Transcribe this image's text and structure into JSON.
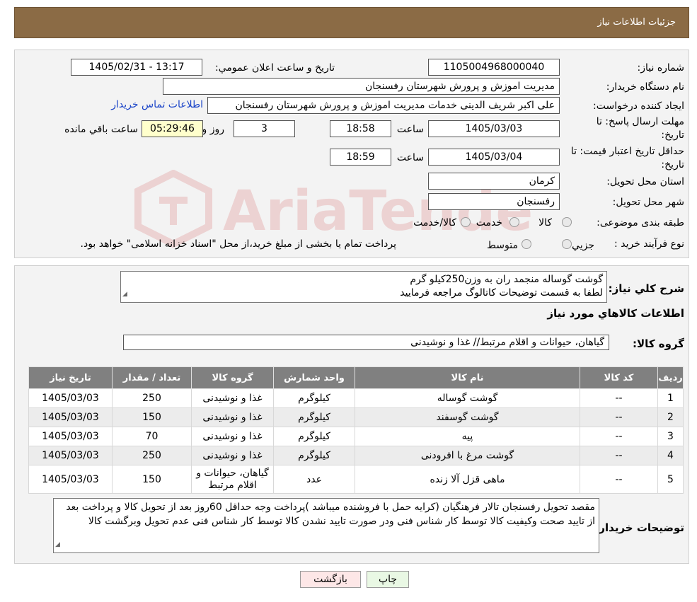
{
  "header": {
    "title": "جزئیات اطلاعات نیاز"
  },
  "watermark": {
    "text": "AriaTender.neT"
  },
  "form": {
    "need_number_label": "شماره نیاز:",
    "need_number": "1105004968000040",
    "announce_label": "تاریخ و ساعت اعلان عمومي:",
    "announce_value": "1405/02/31 - 13:17",
    "buyer_org_label": "نام دستگاه خريدار:",
    "buyer_org": "مديريت اموزش و پرورش شهرستان رفسنجان",
    "creator_label": "ايجاد کننده درخواست:",
    "creator": "علی اکبر شریف الدینی خدمات مدیریت اموزش و پرورش شهرستان رفسنجان",
    "contact_link": "اطلاعات تماس خريدار",
    "reply_deadline_label_1": "مهلت ارسال پاسخ: تا",
    "reply_deadline_label_2": "تاريخ:",
    "reply_date": "1405/03/03",
    "time_label": "ساعت",
    "reply_time": "18:58",
    "days_value": "3",
    "days_label": "روز و",
    "remaining_time": "05:29:46",
    "remaining_label": "ساعت باقي مانده",
    "validity_label_1": "حداقل تاريخ اعتبار قيمت: تا",
    "validity_label_2": "تاريخ:",
    "validity_date": "1405/03/04",
    "validity_time": "18:59",
    "province_label": "استان محل تحويل:",
    "province": "کرمان",
    "city_label": "شهر محل تحويل:",
    "city": "رفسنجان",
    "category_label": "طبقه بندی موضوعی:",
    "category_options": [
      "کالا",
      "خدمت",
      "کالا/خدمت"
    ],
    "process_label": "نوع فرآيند خريد :",
    "process_options": [
      "جزيي",
      "متوسط"
    ],
    "process_note": "پرداخت تمام يا بخشی از مبلغ خريد،از محل \"اسناد خزانه اسلامی\" خواهد بود."
  },
  "summary": {
    "label": "شرح کلي نياز:",
    "line1": "گوشت گوساله منجمد ران به وزن250کیلو گرم",
    "line2": "لطفا به قسمت توضیحات کاتالوگ مراجعه فرمایید"
  },
  "items_section": {
    "title": "اطلاعات کالاهاي مورد نياز",
    "group_label": "گروه کالا:",
    "group_value": "گیاهان، حیوانات و اقلام مرتبط// غذا و نوشیدنی"
  },
  "table": {
    "headers": [
      "رديف",
      "کد کالا",
      "نام کالا",
      "واحد شمارش",
      "گروه کالا",
      "تعداد / مقدار",
      "تاريخ نياز"
    ],
    "rows": [
      [
        "1",
        "--",
        "گوشت گوساله",
        "کیلوگرم",
        "غذا و نوشیدنی",
        "250",
        "1405/03/03"
      ],
      [
        "2",
        "--",
        "گوشت گوسفند",
        "کیلوگرم",
        "غذا و نوشیدنی",
        "150",
        "1405/03/03"
      ],
      [
        "3",
        "--",
        "پیه",
        "کیلوگرم",
        "غذا و نوشیدنی",
        "70",
        "1405/03/03"
      ],
      [
        "4",
        "--",
        "گوشت مرغ با افرودنی",
        "کیلوگرم",
        "غذا و نوشیدنی",
        "250",
        "1405/03/03"
      ],
      [
        "5",
        "--",
        "ماهی قزل آلا زنده",
        "عدد",
        "گیاهان، حیوانات و اقلام مرتبط",
        "150",
        "1405/03/03"
      ]
    ]
  },
  "buyer_notes": {
    "label": "توضيحات خريدار:",
    "text": "مقصد تحویل رفسنجان تالار فرهنگیان (کرایه حمل با فروشنده میباشد )پرداخت وجه حداقل 60روز بعد از تحویل کالا و پرداخت بعد از تایید صحت وکیفیت کالا توسط کار شناس فنی ودر صورت تایید نشدن کالا توسط کار شناس فنی عدم تحویل وبرگشت کالا"
  },
  "buttons": {
    "print": "چاپ",
    "back": "بازگشت"
  },
  "colors": {
    "header_bg": "#8b6b45",
    "table_header_bg": "#808080",
    "link": "#1a44c8",
    "print_bg": "#e9f8e4",
    "back_bg": "#fde7e7"
  }
}
